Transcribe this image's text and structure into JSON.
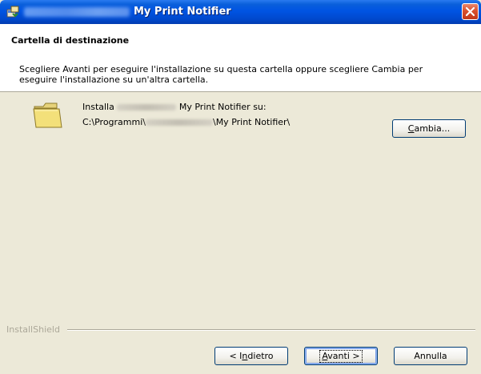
{
  "window": {
    "title": "My Print Notifier",
    "icon": "installer-icon",
    "close": "close-icon"
  },
  "header": {
    "title": "Cartella di destinazione",
    "description": "Scegliere Avanti per eseguire l'installazione su questa cartella oppure scegliere Cambia per eseguire l'installazione su un'altra cartella."
  },
  "content": {
    "folder_icon": "folder-icon",
    "install_prefix": "Installa",
    "install_suffix": "My Print Notifier su:",
    "path_prefix": "C:\\Programmi\\",
    "path_suffix": "\\My Print Notifier\\",
    "change_button": {
      "pre": "",
      "key": "C",
      "post": "ambia..."
    }
  },
  "footer": {
    "brand": "InstallShield",
    "back_button": {
      "pre": "< I",
      "key": "n",
      "post": "dietro"
    },
    "next_button": {
      "pre": "",
      "key": "A",
      "post": "vanti >"
    },
    "cancel_button": "Annulla"
  }
}
